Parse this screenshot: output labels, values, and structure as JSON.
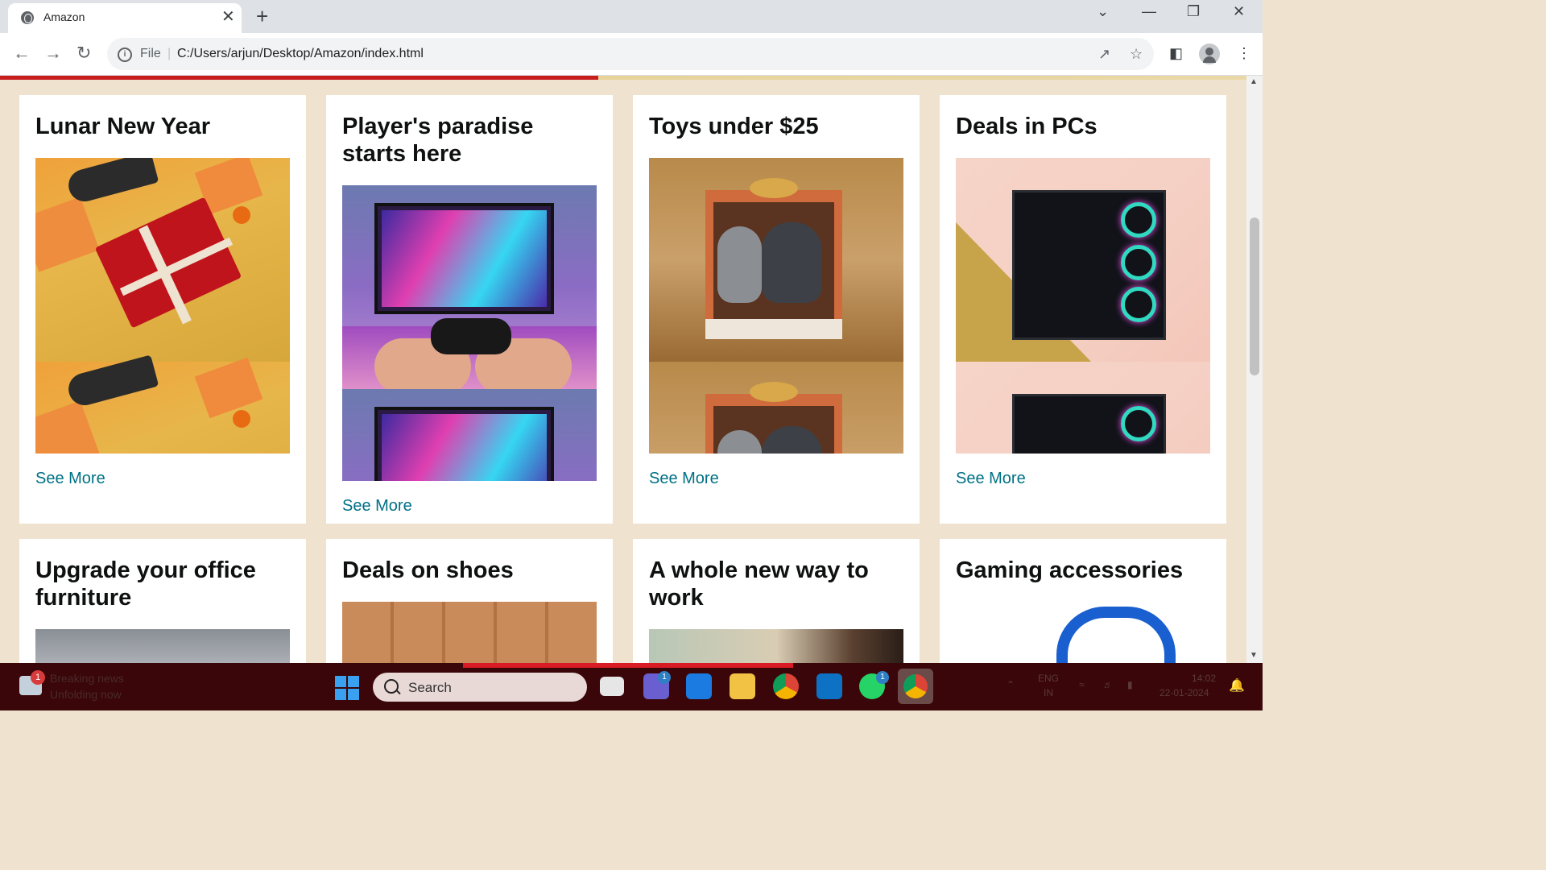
{
  "browser": {
    "tab_title": "Amazon",
    "tab_close": "✕",
    "new_tab": "+",
    "url_scheme": "File",
    "url": "C:/Users/arjun/Desktop/Amazon/index.html",
    "win_min": "—",
    "win_max": "❐",
    "win_close": "✕",
    "tab_search": "⌄"
  },
  "cards_row1": [
    {
      "title": "Lunar New Year",
      "link": "See More"
    },
    {
      "title": "Player's paradise starts here",
      "link": "See More"
    },
    {
      "title": "Toys under $25",
      "link": "See More"
    },
    {
      "title": "Deals in PCs",
      "link": "See More"
    }
  ],
  "cards_row2": [
    {
      "title": "Upgrade your office furniture"
    },
    {
      "title": "Deals on shoes"
    },
    {
      "title": "A whole new way to work"
    },
    {
      "title": "Gaming accessories"
    }
  ],
  "taskbar": {
    "news_title": "Breaking news",
    "news_sub": "Unfolding now",
    "news_badge": "1",
    "search_placeholder": "Search",
    "teams_badge": "1",
    "whatsapp_badge": "1",
    "lang1": "ENG",
    "lang2": "IN",
    "time": "14:02",
    "date": "22-01-2024"
  }
}
